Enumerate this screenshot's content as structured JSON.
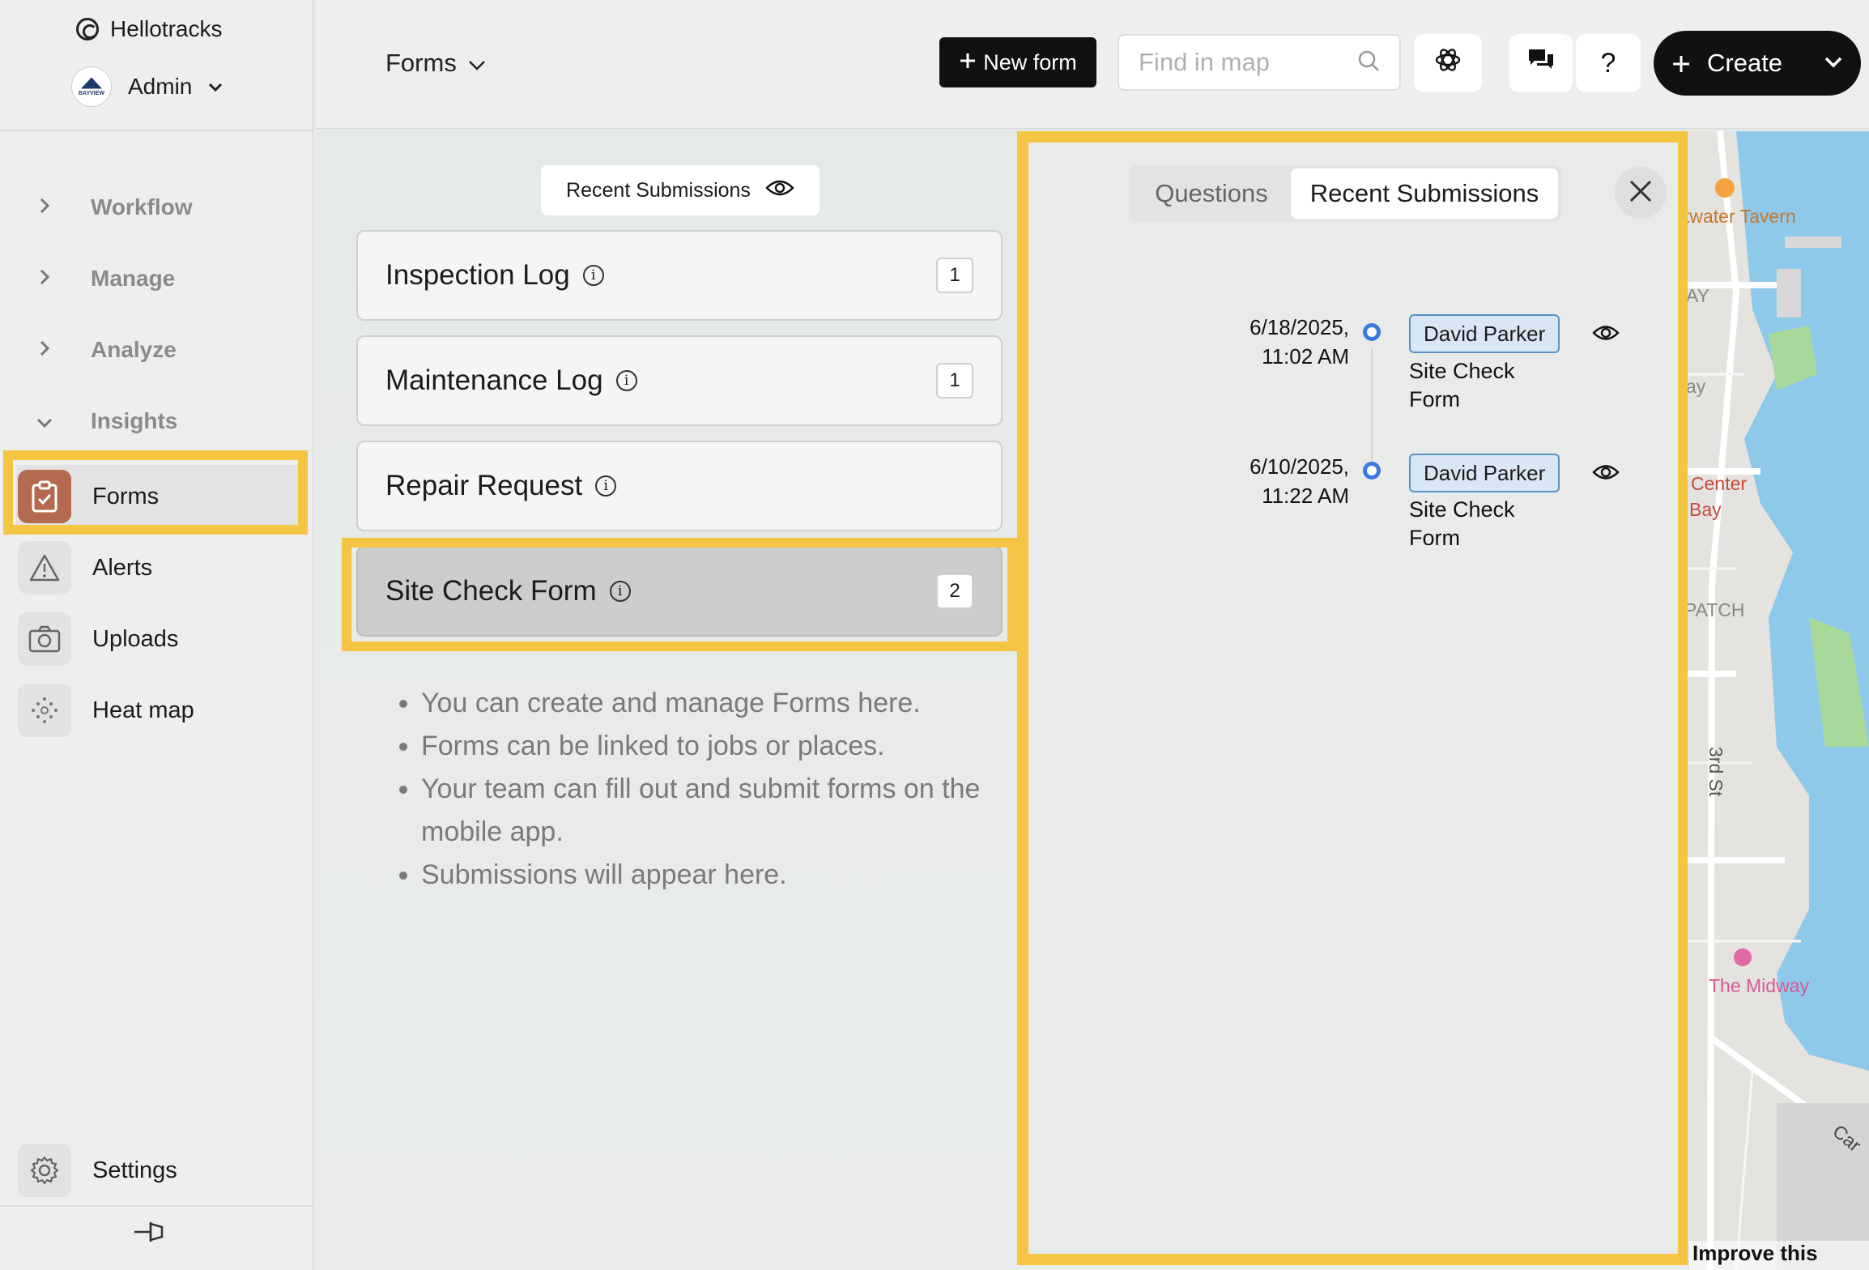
{
  "app": {
    "brand": "Hellotracks"
  },
  "account": {
    "name": "Admin",
    "avatar_text": "BAYVIEW"
  },
  "sidebar": {
    "groups": [
      {
        "label": "Workflow",
        "caret": "›"
      },
      {
        "label": "Manage",
        "caret": "›"
      },
      {
        "label": "Analyze",
        "caret": "›"
      },
      {
        "label": "Insights",
        "caret": "⌄"
      }
    ],
    "items": [
      {
        "label": "Forms",
        "icon": "clipboard-icon",
        "active": true
      },
      {
        "label": "Alerts",
        "icon": "warning-icon",
        "active": false
      },
      {
        "label": "Uploads",
        "icon": "camera-icon",
        "active": false
      },
      {
        "label": "Heat map",
        "icon": "heatmap-dots-icon",
        "active": false
      }
    ],
    "settings_label": "Settings"
  },
  "topbar": {
    "breadcrumb": "Forms",
    "new_form_label": "New form",
    "search_placeholder": "Find in map",
    "help_label": "?",
    "create_label": "Create"
  },
  "forms_panel": {
    "recent_submissions_label": "Recent Submissions",
    "forms": [
      {
        "name": "Inspection Log",
        "count": "1"
      },
      {
        "name": "Maintenance Log",
        "count": "1"
      },
      {
        "name": "Repair Request",
        "count": ""
      },
      {
        "name": "Site Check Form",
        "count": "2",
        "selected": true
      }
    ],
    "tips": [
      "You can create and manage Forms here.",
      "Forms can be linked to jobs or places.",
      "Your team can fill out and submit forms on the mobile app.",
      "Submissions will appear here."
    ]
  },
  "submissions_panel": {
    "tabs": [
      {
        "label": "Questions",
        "active": false
      },
      {
        "label": "Recent Submissions",
        "active": true
      }
    ],
    "submissions": [
      {
        "date": "6/18/2025,",
        "time": "11:02 AM",
        "user": "David Parker",
        "form": "Site Check Form"
      },
      {
        "date": "6/10/2025,",
        "time": "11:22 AM",
        "user": "David Parker",
        "form": "Site Check Form"
      }
    ]
  },
  "map": {
    "labels": [
      "twater Tavern",
      "AY",
      "ay",
      "Center",
      "Bay",
      "PATCH",
      "3rd St",
      "The Midway",
      "Car"
    ],
    "improve_link": "Improve this map"
  },
  "colors": {
    "highlight": "#f4c542",
    "accent_forms": "#b36a4e",
    "timeline_dot": "#3b7be0",
    "map_water": "#8ec9ea"
  }
}
